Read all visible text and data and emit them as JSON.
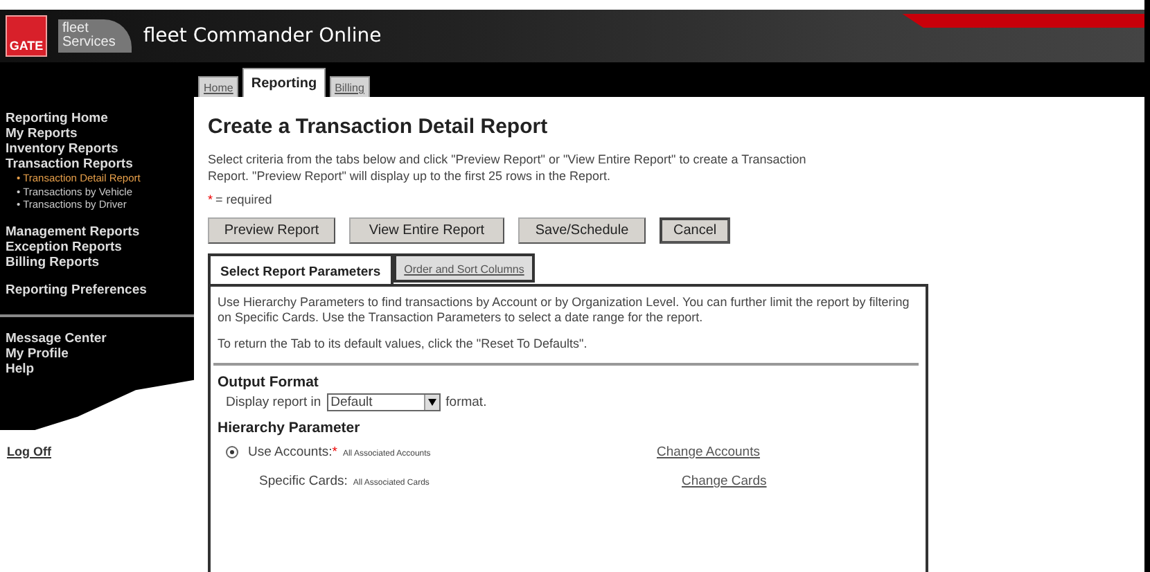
{
  "logo": {
    "badge": "GATE",
    "line_1": "fleet",
    "line_2": "Services"
  },
  "app_title": "fleet Commander Online",
  "nav_tabs": [
    {
      "label": "Home",
      "selected": false
    },
    {
      "label": "Reporting",
      "selected": true
    },
    {
      "label": "Billing",
      "selected": false
    }
  ],
  "sidebar": {
    "groups": [
      [
        {
          "label": "Reporting Home",
          "kind": "link",
          "selected": false
        },
        {
          "label": "My Reports",
          "kind": "link",
          "selected": false
        },
        {
          "label": "Inventory Reports",
          "kind": "link",
          "selected": false
        },
        {
          "label": "Transaction Reports",
          "kind": "link",
          "selected": false
        },
        {
          "label": "• Transaction Detail Report",
          "kind": "sub",
          "selected": true
        },
        {
          "label": "• Transactions by Vehicle",
          "kind": "sub",
          "selected": false
        },
        {
          "label": "• Transactions by Driver",
          "kind": "sub",
          "selected": false
        }
      ],
      [
        {
          "label": "Management Reports",
          "kind": "link",
          "selected": false
        },
        {
          "label": "Exception Reports",
          "kind": "link",
          "selected": false
        },
        {
          "label": "Billing Reports",
          "kind": "link",
          "selected": false
        }
      ],
      [
        {
          "label": "Reporting Preferences",
          "kind": "link",
          "selected": false
        }
      ],
      [
        {
          "label": "Message Center",
          "kind": "link",
          "selected": false
        },
        {
          "label": "My Profile",
          "kind": "link",
          "selected": false
        },
        {
          "label": "Help",
          "kind": "link",
          "selected": false
        }
      ]
    ],
    "logoff": "Log Off"
  },
  "page": {
    "title": "Create a Transaction Detail Report",
    "intro": "Select criteria from the tabs below and click \"Preview Report\" or \"View Entire Report\" to create a Transaction Report. \"Preview Report\" will display up to the first 25 rows in the Report.",
    "required_mark": "*",
    "required_note": "= required",
    "buttons": [
      {
        "label": "Preview Report",
        "kind": "wide"
      },
      {
        "label": "View Entire Report",
        "kind": "wide"
      },
      {
        "label": "Save/Schedule",
        "kind": "wide"
      },
      {
        "label": "Cancel",
        "kind": "outlined"
      }
    ],
    "tabs": [
      {
        "label": "Select Report Parameters",
        "selected": true
      },
      {
        "label": "Order and Sort Columns",
        "selected": false
      }
    ],
    "panel": {
      "help": "Use Hierarchy Parameters to find transactions by Account or by Organization Level. You can further limit the report by filtering on Specific Cards. Use the Transaction Parameters to select a date range for the report.",
      "reset_note": "To return the Tab to its default values, click the \"Reset To Defaults\".",
      "output_format": {
        "heading": "Output Format",
        "prefix": "Display report in",
        "value": "Default",
        "suffix": "format."
      },
      "hierarchy": {
        "heading": "Hierarchy Parameter",
        "rows": [
          {
            "kind": "radio",
            "selected": true,
            "label": "Use Accounts:",
            "required": true,
            "value": "All Associated Accounts",
            "link": "Change Accounts"
          },
          {
            "kind": "plain",
            "label": "Specific Cards:",
            "required": false,
            "value": "All Associated Cards",
            "link": "Change Cards"
          }
        ]
      }
    }
  }
}
